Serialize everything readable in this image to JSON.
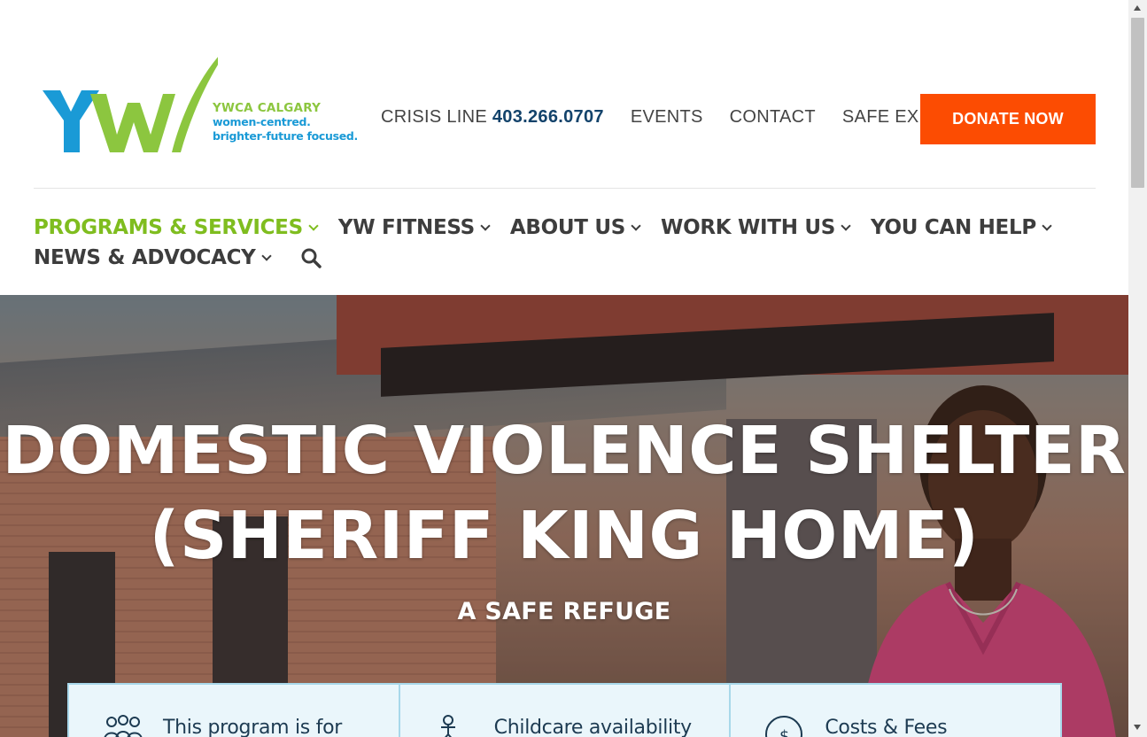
{
  "header": {
    "logo": {
      "org_name": "YWCA CALGARY",
      "tagline_1": "women-centred.",
      "tagline_2": "brighter-future focused.",
      "colors": {
        "green": "#8cc63f",
        "blue": "#1a9ad6"
      }
    },
    "crisis_line": {
      "label": "CRISIS LINE",
      "number": "403.266.0707"
    },
    "utility_links": [
      "EVENTS",
      "CONTACT",
      "SAFE EXIT"
    ],
    "donate_label": "DONATE NOW",
    "donate_color": "#fc4c02"
  },
  "nav": {
    "items": [
      {
        "label": "PROGRAMS & SERVICES",
        "active": true
      },
      {
        "label": "YW FITNESS"
      },
      {
        "label": "ABOUT US"
      },
      {
        "label": "WORK WITH US"
      },
      {
        "label": "YOU CAN HELP"
      },
      {
        "label": "NEWS & ADVOCACY"
      }
    ],
    "search_icon": "search-icon",
    "active_color": "#7fbd1f"
  },
  "hero": {
    "title_line_1": "DOMESTIC VIOLENCE SHELTER",
    "title_line_2": "(SHERIFF KING HOME)",
    "subtitle": "A SAFE REFUGE"
  },
  "info_cards": [
    {
      "label": "This program is for",
      "icon": "people-icon"
    },
    {
      "label": "Childcare availability",
      "icon": "child-icon"
    },
    {
      "label": "Costs & Fees",
      "icon": "dollar-clock-icon"
    }
  ]
}
